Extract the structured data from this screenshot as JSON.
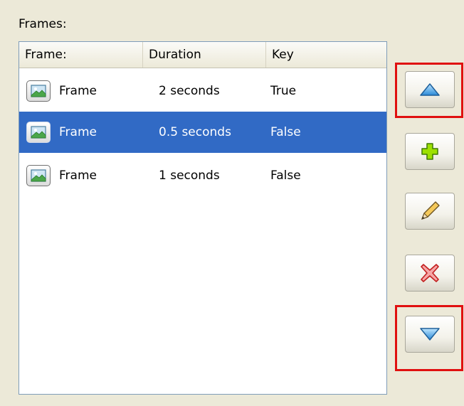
{
  "frames_panel": {
    "label": "Frames:",
    "columns": [
      "Frame:",
      "Duration",
      "Key"
    ],
    "rows": [
      {
        "name": "Frame",
        "duration": "2 seconds",
        "key": "True",
        "selected": false
      },
      {
        "name": "Frame",
        "duration": "0.5 seconds",
        "key": "False",
        "selected": true
      },
      {
        "name": "Frame",
        "duration": "1 seconds",
        "key": "False",
        "selected": false
      }
    ]
  },
  "buttons": [
    {
      "name": "move-up-button",
      "icon": "arrow-up-icon"
    },
    {
      "name": "add-frame-button",
      "icon": "plus-icon"
    },
    {
      "name": "edit-frame-button",
      "icon": "pencil-icon"
    },
    {
      "name": "delete-frame-button",
      "icon": "delete-x-icon"
    },
    {
      "name": "move-down-button",
      "icon": "arrow-down-icon"
    }
  ],
  "colors": {
    "selection": "#316ac5",
    "highlight": "#e01010",
    "window_bg": "#ece9d8"
  }
}
